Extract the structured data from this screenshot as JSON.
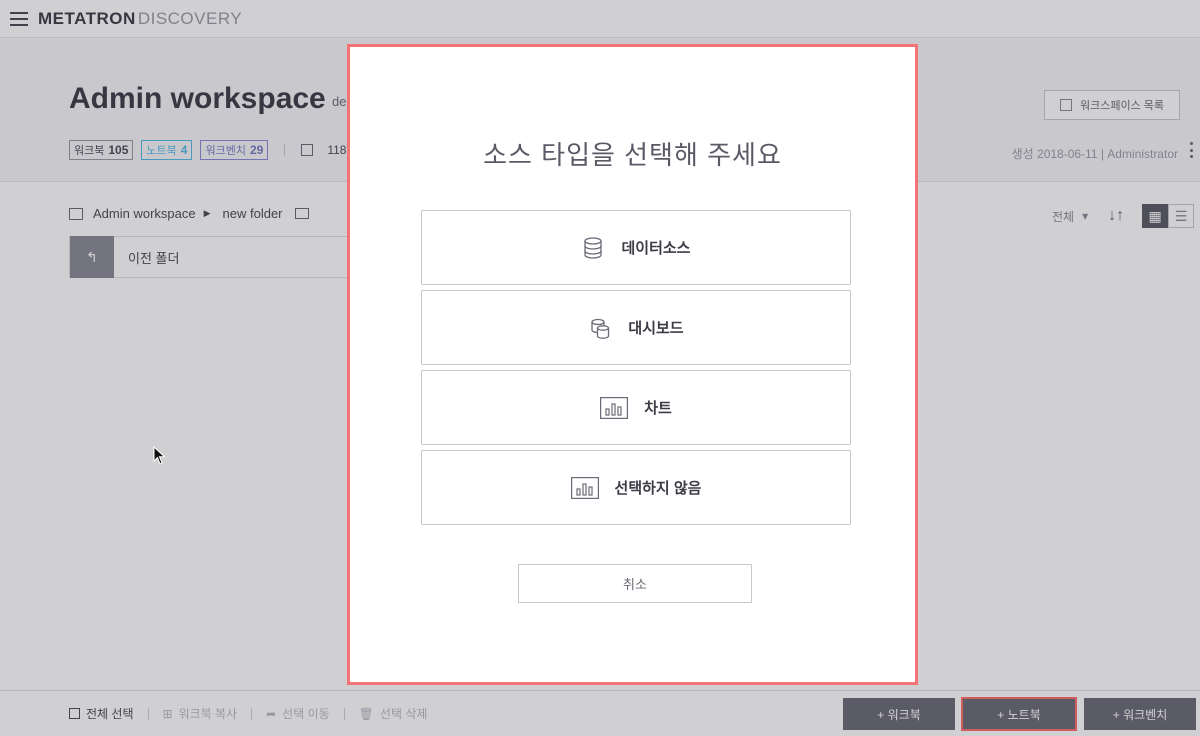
{
  "app": {
    "brand_primary": "METATRON",
    "brand_secondary": "DISCOVERY"
  },
  "workspace": {
    "title": "Admin workspace",
    "description": "de",
    "tags": [
      {
        "label": "워크북",
        "count": "105"
      },
      {
        "label": "노트북",
        "count": "4"
      },
      {
        "label": "워크벤치",
        "count": "29"
      }
    ],
    "copy_count": "118",
    "list_button": "워크스페이스 목록",
    "created": "생성 2018-06-11 | Administrator"
  },
  "breadcrumb": {
    "root": "Admin workspace",
    "current": "new folder"
  },
  "toolbar": {
    "filter": "전체",
    "filter_arrow": "▾",
    "sort": "↓↑",
    "grid_icon": "▦",
    "list_icon": "☰"
  },
  "prev_folder": {
    "label": "이전 폴더",
    "icon": "↰"
  },
  "bottombar": {
    "select_all": "전체 선택",
    "copy": "워크북 복사",
    "move": "선택 이동",
    "delete": "선택 삭제",
    "add_workbook": "+ 워크북",
    "add_notebook": "+ 노트북",
    "add_workbench": "+ 워크벤치"
  },
  "modal": {
    "title": "소스 타입을 선택해 주세요",
    "options": [
      {
        "label": "데이터소스",
        "icon": "database-icon"
      },
      {
        "label": "대시보드",
        "icon": "dashboard-icon"
      },
      {
        "label": "차트",
        "icon": "chart-icon"
      },
      {
        "label": "선택하지 않음",
        "icon": "chart-icon"
      }
    ],
    "cancel": "취소"
  },
  "colors": {
    "accent_outline": "#f27474",
    "button_bg": "#6a6a76"
  }
}
